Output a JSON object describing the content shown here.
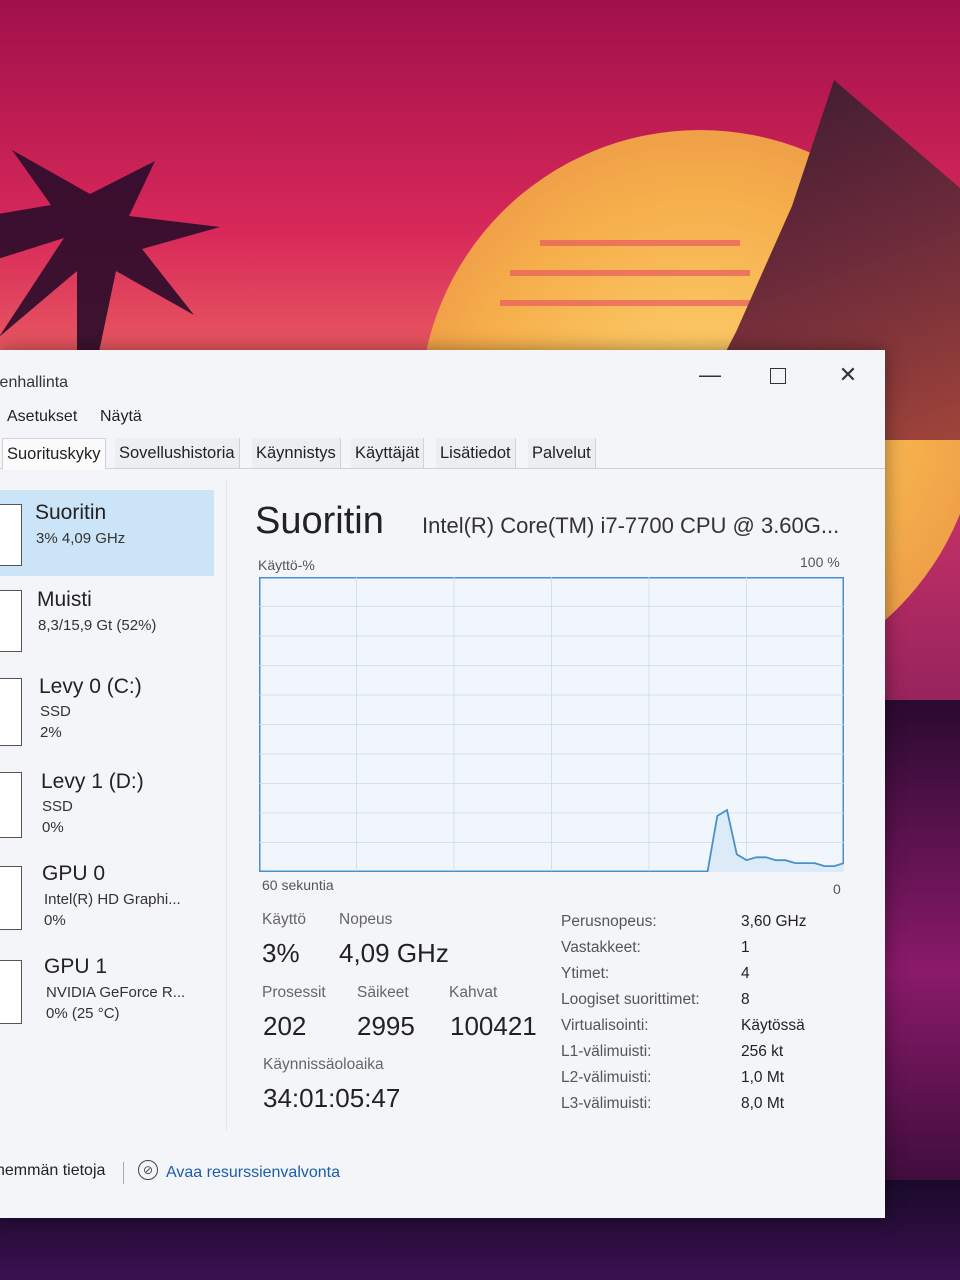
{
  "window": {
    "title": "ienhallinta",
    "controls": {
      "minimize": "—",
      "maximize_icon": "maximize-icon",
      "close": "✕"
    }
  },
  "menu": [
    "Asetukset",
    "Näytä"
  ],
  "tabs": [
    {
      "label": "Suorituskyky",
      "active": true
    },
    {
      "label": "Sovellushistoria",
      "active": false
    },
    {
      "label": "Käynnistys",
      "active": false
    },
    {
      "label": "Käyttäjät",
      "active": false
    },
    {
      "label": "Lisätiedot",
      "active": false
    },
    {
      "label": "Palvelut",
      "active": false
    }
  ],
  "sidebar": [
    {
      "name": "Suoritin",
      "line1": "3% 4,09 GHz",
      "line2": "",
      "selected": true
    },
    {
      "name": "Muisti",
      "line1": "8,3/15,9 Gt (52%)",
      "line2": "",
      "selected": false
    },
    {
      "name": "Levy 0 (C:)",
      "line1": "SSD",
      "line2": "2%",
      "selected": false
    },
    {
      "name": "Levy 1 (D:)",
      "line1": "SSD",
      "line2": "0%",
      "selected": false
    },
    {
      "name": "GPU 0",
      "line1": "Intel(R) HD Graphi...",
      "line2": "0%",
      "selected": false
    },
    {
      "name": "GPU 1",
      "line1": "NVIDIA GeForce R...",
      "line2": "0% (25 °C)",
      "selected": false
    }
  ],
  "main": {
    "title": "Suoritin",
    "cpu_model": "Intel(R) Core(TM) i7-7700 CPU @ 3.60G...",
    "graph_label": "Käyttö-%",
    "graph_max": "100 %",
    "graph_time": "60 sekuntia",
    "graph_min": "0"
  },
  "stats": {
    "usage_label": "Käyttö",
    "usage_value": "3%",
    "speed_label": "Nopeus",
    "speed_value": "4,09 GHz",
    "processes_label": "Prosessit",
    "processes_value": "202",
    "threads_label": "Säikeet",
    "threads_value": "2995",
    "handles_label": "Kahvat",
    "handles_value": "100421",
    "uptime_label": "Käynnissäoloaika",
    "uptime_value": "34:01:05:47"
  },
  "specs": [
    {
      "label": "Perusnopeus:",
      "value": "3,60 GHz"
    },
    {
      "label": "Vastakkeet:",
      "value": "1"
    },
    {
      "label": "Ytimet:",
      "value": "4"
    },
    {
      "label": "Loogiset suorittimet:",
      "value": "8"
    },
    {
      "label": "Virtualisointi:",
      "value": "Käytössä"
    },
    {
      "label": "L1-välimuisti:",
      "value": "256 kt"
    },
    {
      "label": "L2-välimuisti:",
      "value": "1,0 Mt"
    },
    {
      "label": "L3-välimuisti:",
      "value": "8,0 Mt"
    }
  ],
  "footer": {
    "fewer_details": "hemmän tietoja",
    "open_monitor": "Avaa resurssienvalvonta"
  },
  "chart_data": {
    "type": "line",
    "ylim": [
      0,
      100
    ],
    "xlim": [
      60,
      0
    ],
    "x": [
      60,
      58,
      56,
      54,
      52,
      50,
      48,
      46,
      44,
      42,
      40,
      38,
      36,
      34,
      32,
      30,
      28,
      26,
      24,
      22,
      20,
      18,
      16,
      14,
      13,
      12,
      11,
      10,
      9,
      8,
      7,
      6,
      5,
      4,
      3,
      2,
      1,
      0
    ],
    "values": [
      0,
      0,
      0,
      0,
      0,
      0,
      0,
      0,
      0,
      0,
      0,
      0,
      0,
      0,
      0,
      0,
      0,
      0,
      0,
      0,
      0,
      0,
      0,
      0,
      19,
      21,
      6,
      4,
      5,
      5,
      4,
      4,
      3,
      3,
      3,
      2,
      2,
      3
    ],
    "colors": {
      "line": "#4a90c8",
      "fill": "#f1f6fc",
      "grid": "#c6dcef",
      "border": "#4a90c8"
    }
  }
}
